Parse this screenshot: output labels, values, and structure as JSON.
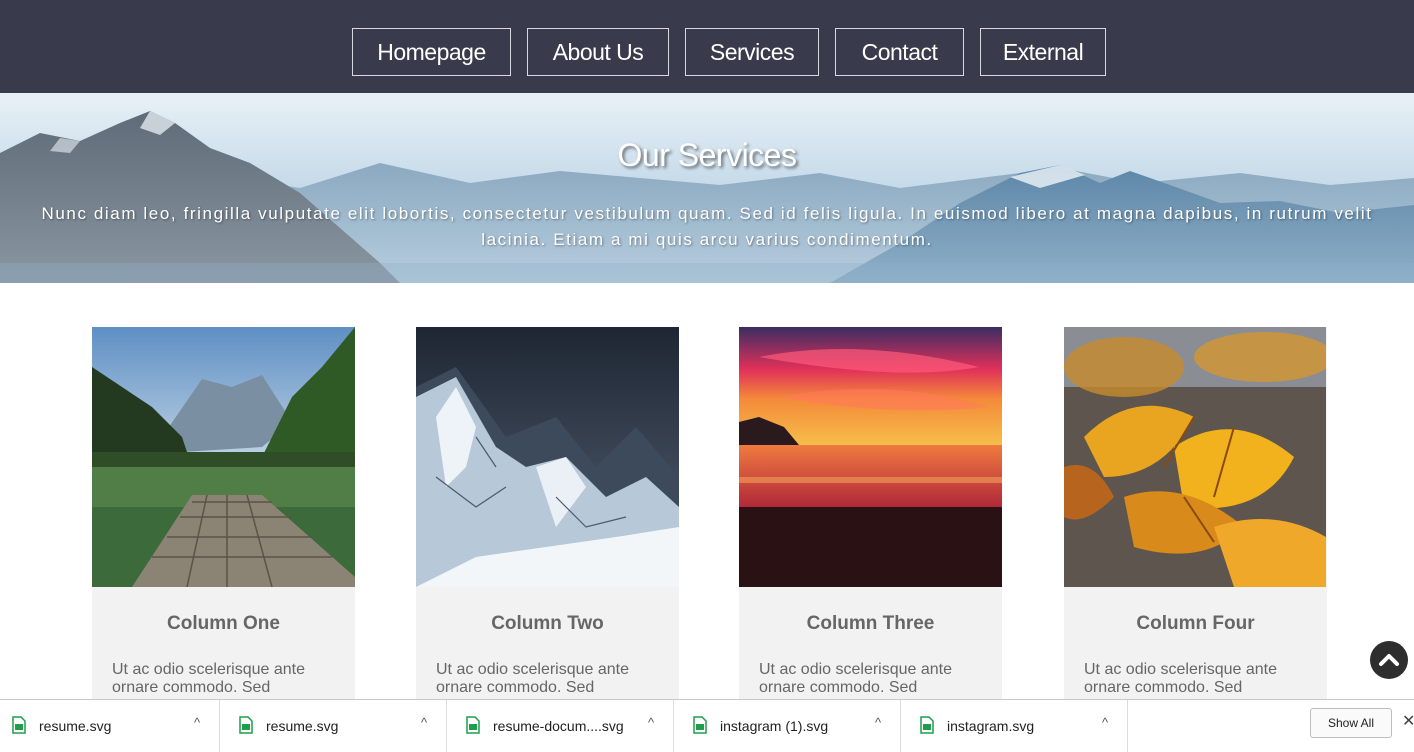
{
  "nav": {
    "items": [
      {
        "label": "Homepage"
      },
      {
        "label": "About Us"
      },
      {
        "label": "Services"
      },
      {
        "label": "Contact"
      },
      {
        "label": "External"
      }
    ]
  },
  "hero": {
    "title": "Our Services",
    "text": "Nunc diam leo, fringilla vulputate elit lobortis, consectetur vestibulum quam. Sed id felis ligula. In euismod libero at magna dapibus, in rutrum velit lacinia. Etiam a mi quis arcu varius condimentum."
  },
  "columns": [
    {
      "title": "Column One",
      "text": "Ut ac odio scelerisque ante ornare commodo. Sed"
    },
    {
      "title": "Column Two",
      "text": "Ut ac odio scelerisque ante ornare commodo. Sed"
    },
    {
      "title": "Column Three",
      "text": "Ut ac odio scelerisque ante ornare commodo. Sed"
    },
    {
      "title": "Column Four",
      "text": "Ut ac odio scelerisque ante ornare commodo. Sed"
    }
  ],
  "downloads": {
    "items": [
      {
        "name": "resume.svg"
      },
      {
        "name": "resume.svg"
      },
      {
        "name": "resume-docum....svg"
      },
      {
        "name": "instagram (1).svg"
      },
      {
        "name": "instagram.svg"
      }
    ],
    "show_all_label": "Show All",
    "close_glyph": "✕",
    "caret_glyph": "^"
  },
  "colors": {
    "nav_bg": "#393b4c",
    "card_bg": "#f2f2f2",
    "text_gray": "#666666",
    "file_icon": "#1e9e4a"
  },
  "icons": {
    "back_to_top": "chevron-up-icon",
    "file": "svg-file-icon"
  }
}
